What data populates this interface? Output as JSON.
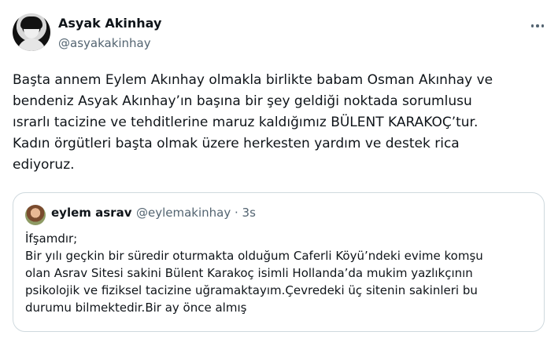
{
  "author": {
    "display_name": "Asyak Akinhay",
    "handle": "@asyakakinhay"
  },
  "tweet": {
    "text_lines": [
      "Başta annem Eylem Akınhay olmakla birlikte babam Osman Akınhay ve",
      "bendeniz Asyak Akınhay’ın başına bir şey geldiği noktada sorumlusu",
      "ısrarlı tacizine ve tehditlerine maruz kaldığımız BÜLENT KARAKOÇ’tur.",
      "Kadın örgütleri başta olmak üzere herkesten yardım ve destek rica",
      "ediyoruz."
    ]
  },
  "quote": {
    "display_name": "eylem asrav",
    "handle_time": "@eylemakinhay · 3s",
    "text_lines": [
      "İfşamdır;",
      "Bir yılı geçkin bir süredir oturmakta olduğum Caferli Köyü’ndeki evime komşu",
      "olan Asrav Sitesi sakini Bülent Karakoç isimli Hollanda’da mukim yazlıkçının",
      "psikolojik ve fiziksel tacizine uğramaktayım.Çevredeki üç sitenin sakinleri bu",
      "durumu bilmektedir.Bir ay önce almış"
    ]
  },
  "icons": {
    "more": "more-horizontal-icon"
  },
  "colors": {
    "text_primary": "#0f1419",
    "text_secondary": "#536471",
    "border": "#cfd9de"
  }
}
